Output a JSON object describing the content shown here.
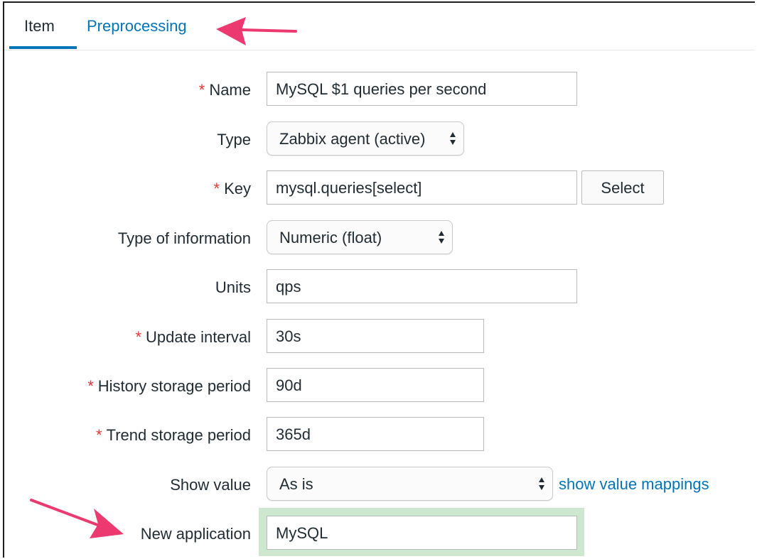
{
  "tabs": {
    "item": "Item",
    "preprocessing": "Preprocessing"
  },
  "form": {
    "name": {
      "label": "Name",
      "required": "*",
      "value": "MySQL $1 queries per second"
    },
    "type": {
      "label": "Type",
      "value": "Zabbix agent (active)"
    },
    "key": {
      "label": "Key",
      "required": "*",
      "value": "mysql.queries[select]",
      "button": "Select"
    },
    "type_of_information": {
      "label": "Type of information",
      "value": "Numeric (float)"
    },
    "units": {
      "label": "Units",
      "value": "qps"
    },
    "update_interval": {
      "label": "Update interval",
      "required": "*",
      "value": "30s"
    },
    "history": {
      "label": "History storage period",
      "required": "*",
      "value": "90d"
    },
    "trend": {
      "label": "Trend storage period",
      "required": "*",
      "value": "365d"
    },
    "show_value": {
      "label": "Show value",
      "value": "As is",
      "link": "show value mappings"
    },
    "new_application": {
      "label": "New application",
      "value": "MySQL"
    }
  },
  "colors": {
    "link": "#0275b8",
    "required": "#e33734",
    "arrow": "#ec3a70",
    "highlight": "#c8e6c9"
  },
  "icons": [
    "updown-arrows-icon",
    "pointer-arrow-icon"
  ]
}
